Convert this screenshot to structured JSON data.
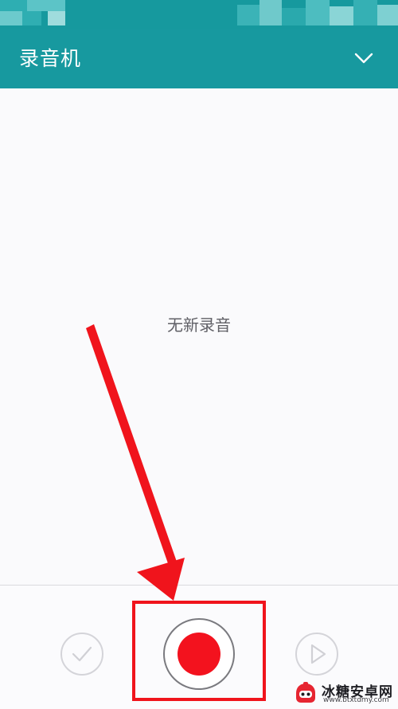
{
  "app": {
    "title": "录音机"
  },
  "main": {
    "empty_text": "无新录音"
  },
  "controls": {
    "confirm_icon": "checkmark-icon",
    "record_icon": "record-icon",
    "play_icon": "play-icon"
  },
  "watermark": {
    "name": "冰糖安卓网",
    "url": "www.btxtdmy.com"
  },
  "colors": {
    "header": "#17999f",
    "record": "#f3121e",
    "annotation": "#f0141c",
    "background": "#fafafc"
  }
}
